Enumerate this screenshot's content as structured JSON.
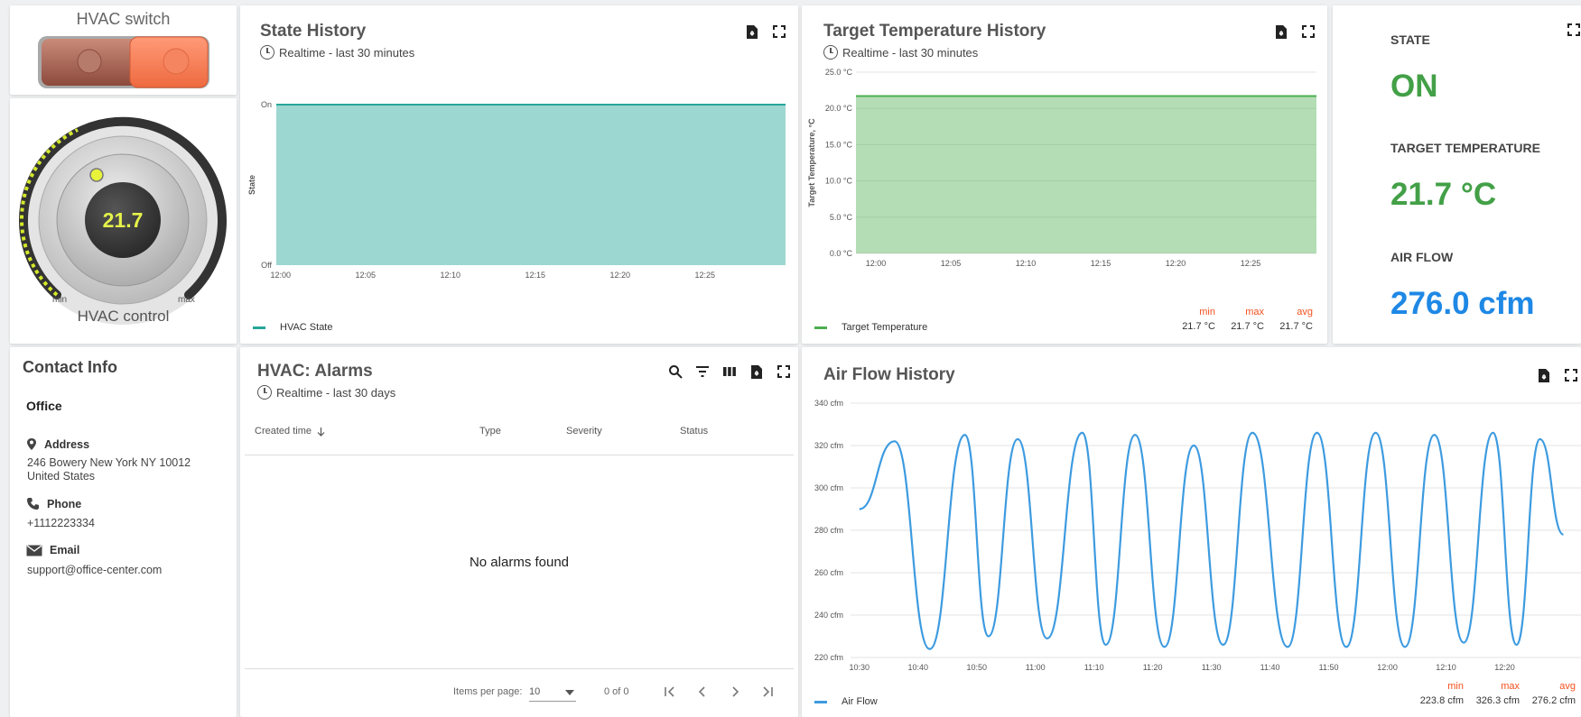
{
  "switch_widget": {
    "title": "HVAC switch"
  },
  "knob_widget": {
    "title": "HVAC control",
    "value": "21.7",
    "min_label": "min",
    "max_label": "max",
    "level": 0.5
  },
  "state_history": {
    "title": "State History",
    "subtitle": "Realtime - last 30 minutes",
    "ylabel": "State",
    "yticks": [
      "On",
      "Off"
    ],
    "xticks": [
      "12:00",
      "12:05",
      "12:10",
      "12:15",
      "12:20",
      "12:25"
    ],
    "legend": "HVAC State",
    "color": "#26a69a"
  },
  "target_history": {
    "title": "Target Temperature History",
    "subtitle": "Realtime - last 30 minutes",
    "ylabel": "Target Temperature, °C",
    "yticks": [
      "25.0 °C",
      "20.0 °C",
      "15.0 °C",
      "10.0 °C",
      "5.0 °C",
      "0.0 °C"
    ],
    "xticks": [
      "12:00",
      "12:05",
      "12:10",
      "12:15",
      "12:20",
      "12:25"
    ],
    "legend": "Target Temperature",
    "color": "#4caf50",
    "stats": {
      "min_label": "min",
      "max_label": "max",
      "avg_label": "avg",
      "min": "21.7 °C",
      "max": "21.7 °C",
      "avg": "21.7 °C"
    }
  },
  "status_panel": {
    "state_label": "STATE",
    "state_value": "ON",
    "target_label": "TARGET TEMPERATURE",
    "target_value": "21.7 °C",
    "airflow_label": "AIR FLOW",
    "airflow_value": "276.0 cfm",
    "colors": {
      "state": "#43a047",
      "target": "#43a047",
      "airflow": "#1e88e5"
    }
  },
  "contact": {
    "title": "Contact Info",
    "name": "Office",
    "address_label": "Address",
    "address_line1": "246 Bowery New York NY 10012",
    "address_line2": "United States",
    "phone_label": "Phone",
    "phone": "+1112223334",
    "email_label": "Email",
    "email": "support@office-center.com"
  },
  "alarms": {
    "title": "HVAC: Alarms",
    "subtitle": "Realtime - last 30 days",
    "columns": [
      "Created time",
      "Type",
      "Severity",
      "Status"
    ],
    "empty_text": "No alarms found",
    "items_per_page_label": "Items per page:",
    "items_per_page": "10",
    "range": "0 of 0"
  },
  "airflow_history": {
    "title": "Air Flow History",
    "legend": "Air Flow",
    "color": "#3d9be0",
    "stats": {
      "min_label": "min",
      "max_label": "max",
      "avg_label": "avg",
      "min": "223.8 cfm",
      "max": "326.3 cfm",
      "avg": "276.2 cfm"
    }
  },
  "chart_data": [
    {
      "type": "area",
      "title": "State History",
      "ylabel": "State",
      "categories": [
        "12:00",
        "12:05",
        "12:10",
        "12:15",
        "12:20",
        "12:25"
      ],
      "series": [
        {
          "name": "HVAC State",
          "values": [
            1,
            1,
            1,
            1,
            1,
            1
          ]
        }
      ],
      "yticks": [
        "Off",
        "On"
      ]
    },
    {
      "type": "area",
      "title": "Target Temperature History",
      "ylabel": "Target Temperature, °C",
      "categories": [
        "12:00",
        "12:05",
        "12:10",
        "12:15",
        "12:20",
        "12:25"
      ],
      "series": [
        {
          "name": "Target Temperature",
          "values": [
            21.7,
            21.7,
            21.7,
            21.7,
            21.7,
            21.7
          ]
        }
      ],
      "ylim": [
        0,
        25
      ]
    },
    {
      "type": "line",
      "title": "Air Flow History",
      "ylim": [
        220,
        340
      ],
      "yticks": [
        "340 cfm",
        "320 cfm",
        "300 cfm",
        "280 cfm",
        "260 cfm",
        "240 cfm",
        "220 cfm"
      ],
      "xticks": [
        "10:30",
        "10:40",
        "10:50",
        "11:00",
        "11:10",
        "11:20",
        "11:30",
        "11:40",
        "11:50",
        "12:00",
        "12:10",
        "12:20"
      ],
      "series": [
        {
          "name": "Air Flow",
          "x": [
            "10:30",
            "10:36",
            "10:42",
            "10:48",
            "10:52",
            "10:57",
            "11:02",
            "11:08",
            "11:12",
            "11:17",
            "11:22",
            "11:27",
            "11:32",
            "11:37",
            "11:43",
            "11:48",
            "11:53",
            "11:58",
            "12:03",
            "12:08",
            "12:13",
            "12:18",
            "12:22",
            "12:26",
            "12:30"
          ],
          "values": [
            290,
            322,
            224,
            325,
            230,
            323,
            229,
            326,
            226,
            325,
            225,
            320,
            226,
            326,
            225,
            326,
            225,
            326,
            225,
            325,
            227,
            326,
            226,
            323,
            278
          ]
        }
      ]
    }
  ]
}
